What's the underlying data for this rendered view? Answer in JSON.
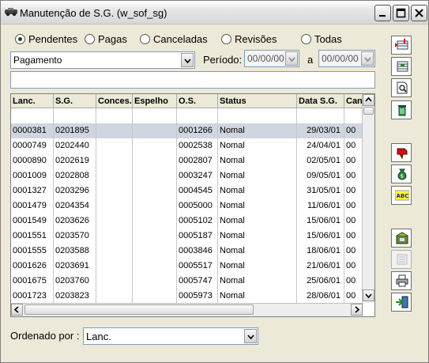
{
  "window": {
    "title": "Manutenção de S.G. (w_sof_sg)"
  },
  "filters": {
    "radios": [
      {
        "label": "Pendentes",
        "selected": true
      },
      {
        "label": "Pagas",
        "selected": false
      },
      {
        "label": "Canceladas",
        "selected": false
      },
      {
        "label": "Revisões",
        "selected": false
      },
      {
        "label": "Todas",
        "selected": false
      }
    ],
    "type_select": "Pagamento",
    "periodo_label": "Período:",
    "date_from": "00/00/00",
    "a_label": "a",
    "date_to": "00/00/00",
    "search_value": ""
  },
  "grid": {
    "columns": [
      "Lanc.",
      "S.G.",
      "Conces.",
      "Espelho",
      "O.S.",
      "Status",
      "Data S.G.",
      "Can"
    ],
    "rows": [
      [
        "",
        "",
        "",
        "",
        "",
        "",
        "",
        ""
      ],
      [
        "0000381",
        "0201895",
        "",
        "",
        "0001266",
        "Nomal",
        "29/03/01",
        "00"
      ],
      [
        "0000749",
        "0202440",
        "",
        "",
        "0002538",
        "Nomal",
        "24/04/01",
        "00"
      ],
      [
        "0000890",
        "0202619",
        "",
        "",
        "0002807",
        "Nomal",
        "02/05/01",
        "00"
      ],
      [
        "0001009",
        "0202808",
        "",
        "",
        "0003247",
        "Nomal",
        "09/05/01",
        "00"
      ],
      [
        "0001327",
        "0203296",
        "",
        "",
        "0004545",
        "Nomal",
        "31/05/01",
        "00"
      ],
      [
        "0001479",
        "0204354",
        "",
        "",
        "0005000",
        "Nomal",
        "11/06/01",
        "00"
      ],
      [
        "0001549",
        "0203626",
        "",
        "",
        "0005102",
        "Nomal",
        "15/06/01",
        "00"
      ],
      [
        "0001551",
        "0203570",
        "",
        "",
        "0005187",
        "Nomal",
        "15/06/01",
        "00"
      ],
      [
        "0001555",
        "0203588",
        "",
        "",
        "0003846",
        "Nomal",
        "18/06/01",
        "00"
      ],
      [
        "0001626",
        "0203691",
        "",
        "",
        "0005517",
        "Nomal",
        "21/06/01",
        "00"
      ],
      [
        "0001675",
        "0203760",
        "",
        "",
        "0005747",
        "Nomal",
        "25/06/01",
        "00"
      ],
      [
        "0001723",
        "0203823",
        "",
        "",
        "0005973",
        "Nomal",
        "28/06/01",
        "00"
      ]
    ]
  },
  "footer": {
    "order_label": "Ordenado por :",
    "order_value": "Lanc."
  },
  "toolbar_icons": [
    "add-record-icon",
    "edit-list-icon",
    "preview-icon",
    "delete-icon",
    "thumbs-down-icon",
    "money-bag-icon",
    "spellcheck-icon",
    "save-box-icon",
    "list-disabled-icon",
    "print-icon",
    "exit-icon"
  ],
  "colors": {
    "selected_row": "#d1d5e0",
    "window_bg": "#ece9d8"
  }
}
